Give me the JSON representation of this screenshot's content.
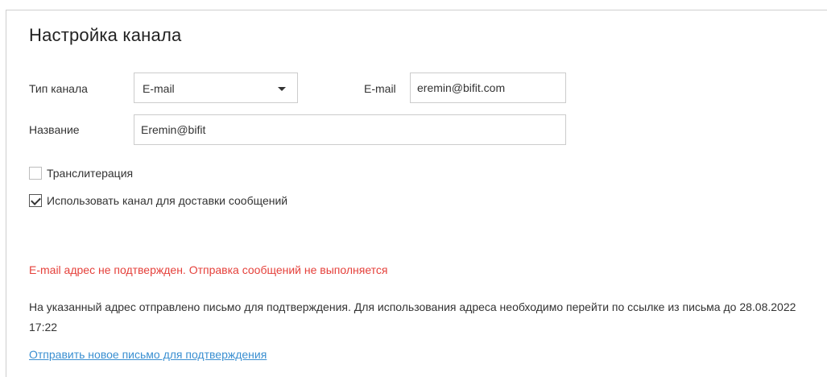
{
  "page_title": "Настройка канала",
  "form": {
    "channel_type_label": "Тип канала",
    "channel_type_value": "E-mail",
    "email_label": "E-mail",
    "email_value": "eremin@bifit.com",
    "name_label": "Название",
    "name_value": "Eremin@bifit"
  },
  "options": {
    "transliteration_label": "Транслитерация",
    "transliteration_checked": false,
    "use_channel_label": "Использовать канал для доставки сообщений",
    "use_channel_checked": true
  },
  "messages": {
    "error": "E-mail адрес не подтвержден. Отправка сообщений не выполняется",
    "info": "На указанный адрес отправлено письмо для подтверждения. Для использования адреса необходимо перейти по ссылке из письма до 28.08.2022 17:22",
    "resend_link": "Отправить новое письмо для подтверждения"
  },
  "colors": {
    "error": "#e5413b",
    "link": "#3a8fd1"
  }
}
